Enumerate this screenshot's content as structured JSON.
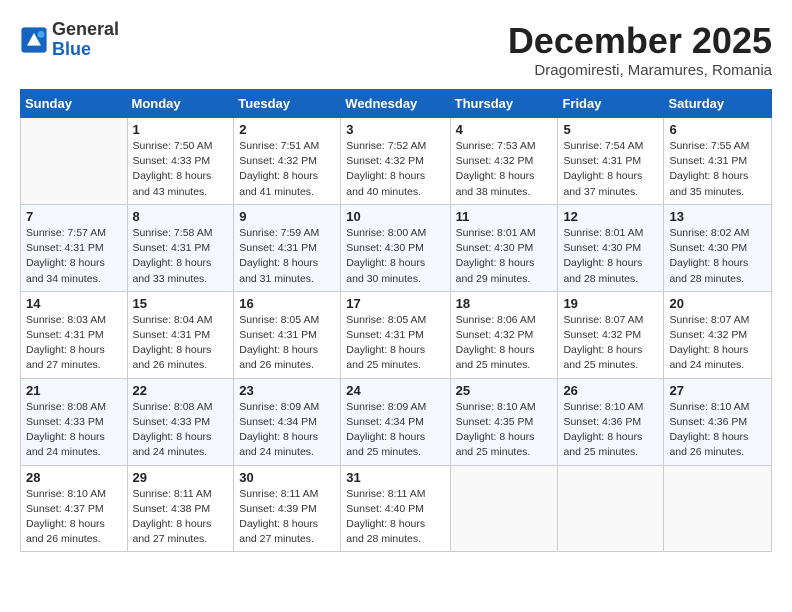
{
  "logo": {
    "general": "General",
    "blue": "Blue"
  },
  "title": "December 2025",
  "location": "Dragomiresti, Maramures, Romania",
  "days_of_week": [
    "Sunday",
    "Monday",
    "Tuesday",
    "Wednesday",
    "Thursday",
    "Friday",
    "Saturday"
  ],
  "weeks": [
    [
      {
        "day": "",
        "sunrise": "",
        "sunset": "",
        "daylight": ""
      },
      {
        "day": "1",
        "sunrise": "Sunrise: 7:50 AM",
        "sunset": "Sunset: 4:33 PM",
        "daylight": "Daylight: 8 hours and 43 minutes."
      },
      {
        "day": "2",
        "sunrise": "Sunrise: 7:51 AM",
        "sunset": "Sunset: 4:32 PM",
        "daylight": "Daylight: 8 hours and 41 minutes."
      },
      {
        "day": "3",
        "sunrise": "Sunrise: 7:52 AM",
        "sunset": "Sunset: 4:32 PM",
        "daylight": "Daylight: 8 hours and 40 minutes."
      },
      {
        "day": "4",
        "sunrise": "Sunrise: 7:53 AM",
        "sunset": "Sunset: 4:32 PM",
        "daylight": "Daylight: 8 hours and 38 minutes."
      },
      {
        "day": "5",
        "sunrise": "Sunrise: 7:54 AM",
        "sunset": "Sunset: 4:31 PM",
        "daylight": "Daylight: 8 hours and 37 minutes."
      },
      {
        "day": "6",
        "sunrise": "Sunrise: 7:55 AM",
        "sunset": "Sunset: 4:31 PM",
        "daylight": "Daylight: 8 hours and 35 minutes."
      }
    ],
    [
      {
        "day": "7",
        "sunrise": "Sunrise: 7:57 AM",
        "sunset": "Sunset: 4:31 PM",
        "daylight": "Daylight: 8 hours and 34 minutes."
      },
      {
        "day": "8",
        "sunrise": "Sunrise: 7:58 AM",
        "sunset": "Sunset: 4:31 PM",
        "daylight": "Daylight: 8 hours and 33 minutes."
      },
      {
        "day": "9",
        "sunrise": "Sunrise: 7:59 AM",
        "sunset": "Sunset: 4:31 PM",
        "daylight": "Daylight: 8 hours and 31 minutes."
      },
      {
        "day": "10",
        "sunrise": "Sunrise: 8:00 AM",
        "sunset": "Sunset: 4:30 PM",
        "daylight": "Daylight: 8 hours and 30 minutes."
      },
      {
        "day": "11",
        "sunrise": "Sunrise: 8:01 AM",
        "sunset": "Sunset: 4:30 PM",
        "daylight": "Daylight: 8 hours and 29 minutes."
      },
      {
        "day": "12",
        "sunrise": "Sunrise: 8:01 AM",
        "sunset": "Sunset: 4:30 PM",
        "daylight": "Daylight: 8 hours and 28 minutes."
      },
      {
        "day": "13",
        "sunrise": "Sunrise: 8:02 AM",
        "sunset": "Sunset: 4:30 PM",
        "daylight": "Daylight: 8 hours and 28 minutes."
      }
    ],
    [
      {
        "day": "14",
        "sunrise": "Sunrise: 8:03 AM",
        "sunset": "Sunset: 4:31 PM",
        "daylight": "Daylight: 8 hours and 27 minutes."
      },
      {
        "day": "15",
        "sunrise": "Sunrise: 8:04 AM",
        "sunset": "Sunset: 4:31 PM",
        "daylight": "Daylight: 8 hours and 26 minutes."
      },
      {
        "day": "16",
        "sunrise": "Sunrise: 8:05 AM",
        "sunset": "Sunset: 4:31 PM",
        "daylight": "Daylight: 8 hours and 26 minutes."
      },
      {
        "day": "17",
        "sunrise": "Sunrise: 8:05 AM",
        "sunset": "Sunset: 4:31 PM",
        "daylight": "Daylight: 8 hours and 25 minutes."
      },
      {
        "day": "18",
        "sunrise": "Sunrise: 8:06 AM",
        "sunset": "Sunset: 4:32 PM",
        "daylight": "Daylight: 8 hours and 25 minutes."
      },
      {
        "day": "19",
        "sunrise": "Sunrise: 8:07 AM",
        "sunset": "Sunset: 4:32 PM",
        "daylight": "Daylight: 8 hours and 25 minutes."
      },
      {
        "day": "20",
        "sunrise": "Sunrise: 8:07 AM",
        "sunset": "Sunset: 4:32 PM",
        "daylight": "Daylight: 8 hours and 24 minutes."
      }
    ],
    [
      {
        "day": "21",
        "sunrise": "Sunrise: 8:08 AM",
        "sunset": "Sunset: 4:33 PM",
        "daylight": "Daylight: 8 hours and 24 minutes."
      },
      {
        "day": "22",
        "sunrise": "Sunrise: 8:08 AM",
        "sunset": "Sunset: 4:33 PM",
        "daylight": "Daylight: 8 hours and 24 minutes."
      },
      {
        "day": "23",
        "sunrise": "Sunrise: 8:09 AM",
        "sunset": "Sunset: 4:34 PM",
        "daylight": "Daylight: 8 hours and 24 minutes."
      },
      {
        "day": "24",
        "sunrise": "Sunrise: 8:09 AM",
        "sunset": "Sunset: 4:34 PM",
        "daylight": "Daylight: 8 hours and 25 minutes."
      },
      {
        "day": "25",
        "sunrise": "Sunrise: 8:10 AM",
        "sunset": "Sunset: 4:35 PM",
        "daylight": "Daylight: 8 hours and 25 minutes."
      },
      {
        "day": "26",
        "sunrise": "Sunrise: 8:10 AM",
        "sunset": "Sunset: 4:36 PM",
        "daylight": "Daylight: 8 hours and 25 minutes."
      },
      {
        "day": "27",
        "sunrise": "Sunrise: 8:10 AM",
        "sunset": "Sunset: 4:36 PM",
        "daylight": "Daylight: 8 hours and 26 minutes."
      }
    ],
    [
      {
        "day": "28",
        "sunrise": "Sunrise: 8:10 AM",
        "sunset": "Sunset: 4:37 PM",
        "daylight": "Daylight: 8 hours and 26 minutes."
      },
      {
        "day": "29",
        "sunrise": "Sunrise: 8:11 AM",
        "sunset": "Sunset: 4:38 PM",
        "daylight": "Daylight: 8 hours and 27 minutes."
      },
      {
        "day": "30",
        "sunrise": "Sunrise: 8:11 AM",
        "sunset": "Sunset: 4:39 PM",
        "daylight": "Daylight: 8 hours and 27 minutes."
      },
      {
        "day": "31",
        "sunrise": "Sunrise: 8:11 AM",
        "sunset": "Sunset: 4:40 PM",
        "daylight": "Daylight: 8 hours and 28 minutes."
      },
      {
        "day": "",
        "sunrise": "",
        "sunset": "",
        "daylight": ""
      },
      {
        "day": "",
        "sunrise": "",
        "sunset": "",
        "daylight": ""
      },
      {
        "day": "",
        "sunrise": "",
        "sunset": "",
        "daylight": ""
      }
    ]
  ]
}
